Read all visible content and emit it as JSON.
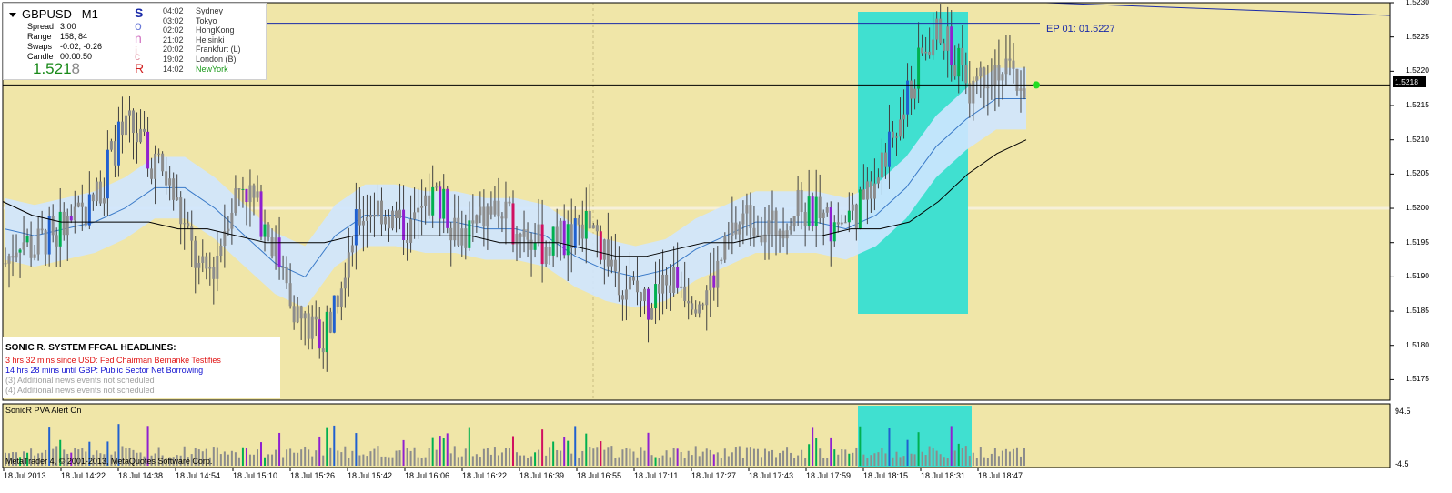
{
  "symbol": {
    "name": "GBPUSD",
    "timeframe": "M1"
  },
  "stats": [
    {
      "label": "Spread",
      "value": "3.00"
    },
    {
      "label": "Range",
      "value": "158, 84"
    },
    {
      "label": "Swaps",
      "value": "-0.02, -0.26"
    },
    {
      "label": "Candle",
      "value": "00:00:50"
    }
  ],
  "price_display": {
    "main": "1.521",
    "last_digit": "8"
  },
  "sonic_letters": [
    "S",
    "o",
    "n",
    "i",
    "c",
    "R"
  ],
  "sessions": [
    {
      "time": "04:02",
      "name": "Sydney"
    },
    {
      "time": "03:02",
      "name": "Tokyo"
    },
    {
      "time": "02:02",
      "name": "HongKong"
    },
    {
      "time": "21:02",
      "name": "Helsinki"
    },
    {
      "time": "20:02",
      "name": "Frankfurt  (L)"
    },
    {
      "time": "19:02",
      "name": "London  (B)"
    },
    {
      "time": "14:02",
      "name": "NewYork"
    }
  ],
  "news": {
    "title": "SONIC R. SYSTEM  FFCAL HEADLINES:",
    "lines": [
      "3 hrs 32 mins since USD: Fed Chairman Bernanke Testifies",
      "14 hrs 28 mins until GBP: Public Sector Net Borrowing",
      "(3)  Additional news events not scheduled",
      "(4)  Additional news events not scheduled"
    ]
  },
  "indicator": {
    "label": "SonicR PVA    Alert On",
    "max": "94.5",
    "min": "-4.5"
  },
  "copyright": "MetaTrader 4, © 2001-2013, MetaQuotes Software Corp.",
  "ep_label": "EP 01:  01.5227",
  "current_price": "1.5218",
  "colors": {
    "background": "#f0e6a8",
    "panel": "#f0e6a8",
    "box": "#40e0d0",
    "bull": "#00b050",
    "bear": "#d01060",
    "neutral": "#8c8c8c",
    "climax_up": "#2060d0",
    "climax_down": "#9020d0",
    "dragon": "#cfe6ff",
    "ema": "#000000",
    "ep_line": "#1a2aa8"
  },
  "chart_data": {
    "type": "candlestick",
    "symbol": "GBPUSD",
    "timeframe": "M1",
    "price_ticks": [
      "1.5230",
      "1.5225",
      "1.5220",
      "1.5215",
      "1.5210",
      "1.5205",
      "1.5200",
      "1.5195",
      "1.5190",
      "1.5185",
      "1.5180",
      "1.5175"
    ],
    "x_labels": [
      "18 Jul 2013",
      "18 Jul 14:22",
      "18 Jul 14:38",
      "18 Jul 14:54",
      "18 Jul 15:10",
      "18 Jul 15:26",
      "18 Jul 15:42",
      "18 Jul 16:06",
      "18 Jul 16:22",
      "18 Jul 16:39",
      "18 Jul 16:55",
      "18 Jul 17:11",
      "18 Jul 17:27",
      "18 Jul 17:43",
      "18 Jul 17:59",
      "18 Jul 18:15",
      "18 Jul 18:31",
      "18 Jul 18:47"
    ],
    "price_path": [
      1.5192,
      1.5196,
      1.5194,
      1.5196,
      1.5197,
      1.5198,
      1.52,
      1.5204,
      1.521,
      1.5212,
      1.5208,
      1.5206,
      1.5202,
      1.5196,
      1.519,
      1.5192,
      1.52,
      1.5204,
      1.52,
      1.5196,
      1.519,
      1.5184,
      1.5182,
      1.5182,
      1.519,
      1.5198,
      1.52,
      1.52,
      1.5198,
      1.5197,
      1.52,
      1.5202,
      1.5198,
      1.5196,
      1.5198,
      1.52,
      1.5198,
      1.5197,
      1.5195,
      1.5194,
      1.5196,
      1.5197,
      1.5197,
      1.5194,
      1.519,
      1.5188,
      1.5186,
      1.5188,
      1.519,
      1.5188,
      1.5187,
      1.5191,
      1.5196,
      1.5199,
      1.5198,
      1.5197,
      1.5199,
      1.52,
      1.5199,
      1.5198,
      1.5198,
      1.52,
      1.5204,
      1.5208,
      1.5212,
      1.5218,
      1.5224,
      1.5226,
      1.5222,
      1.5218,
      1.522,
      1.5221,
      1.5219,
      1.5218
    ],
    "dragon_mid": [
      1.5197,
      1.5196,
      1.5197,
      1.5198,
      1.52,
      1.5203,
      1.5203,
      1.52,
      1.5196,
      1.5192,
      1.519,
      1.5196,
      1.5199,
      1.5199,
      1.5198,
      1.5198,
      1.5197,
      1.5197,
      1.5196,
      1.5193,
      1.5191,
      1.519,
      1.5191,
      1.5194,
      1.5196,
      1.5198,
      1.5198,
      1.5198,
      1.5197,
      1.5199,
      1.5203,
      1.5209,
      1.5213,
      1.5216,
      1.5216
    ],
    "ema_slow": [
      1.5201,
      1.5199,
      1.5198,
      1.5198,
      1.5198,
      1.5198,
      1.5197,
      1.5197,
      1.5196,
      1.5195,
      1.5195,
      1.5195,
      1.5196,
      1.5196,
      1.5196,
      1.5196,
      1.5196,
      1.5195,
      1.5195,
      1.5195,
      1.5194,
      1.5193,
      1.5193,
      1.5194,
      1.5195,
      1.5195,
      1.5196,
      1.5196,
      1.5196,
      1.5197,
      1.5197,
      1.5198,
      1.5201,
      1.5205,
      1.5208,
      1.521
    ],
    "ep_level": 1.5227,
    "current": 1.5218,
    "ylim": [
      1.5172,
      1.523
    ]
  }
}
